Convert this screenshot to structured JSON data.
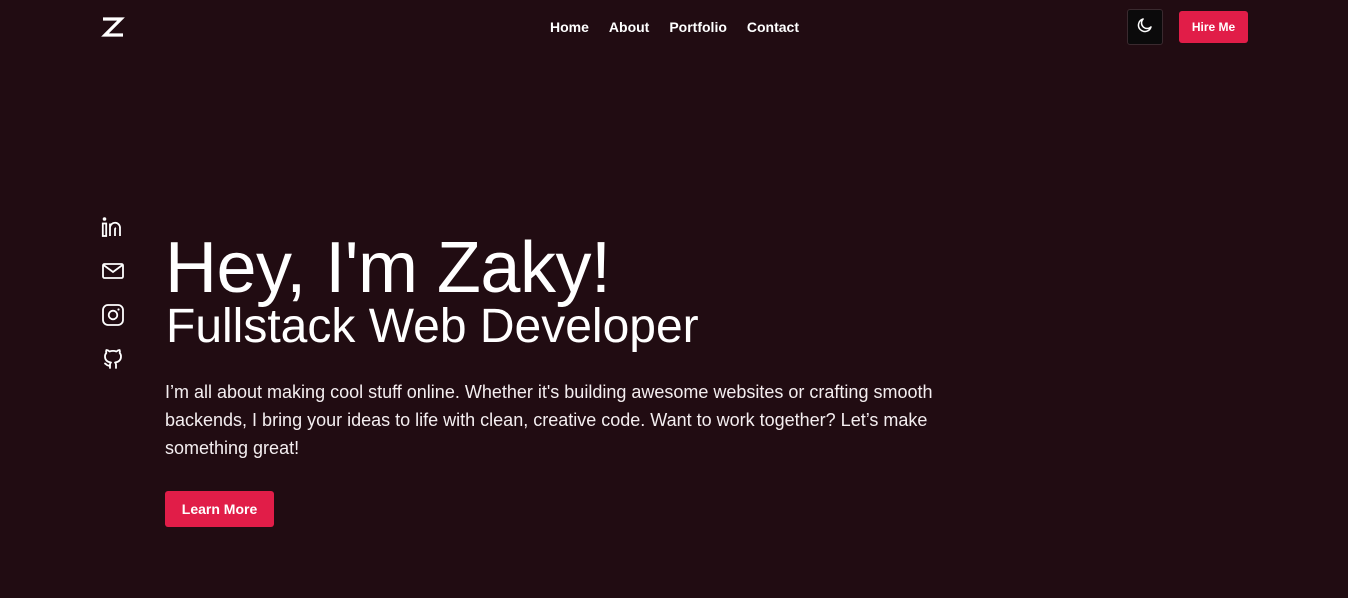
{
  "header": {
    "logo_icon": "z-logo-icon",
    "nav": [
      {
        "label": "Home"
      },
      {
        "label": "About"
      },
      {
        "label": "Portfolio"
      },
      {
        "label": "Contact"
      }
    ],
    "theme_toggle_icon": "moon-icon",
    "hire_label": "Hire Me"
  },
  "social": [
    {
      "icon": "linkedin-icon"
    },
    {
      "icon": "mail-icon"
    },
    {
      "icon": "instagram-icon"
    },
    {
      "icon": "github-icon"
    }
  ],
  "hero": {
    "title": "Hey, I'm Zaky!",
    "subtitle": "Fullstack Web Developer",
    "description": "I’m all about making cool stuff online. Whether it's building awesome websites or crafting smooth backends, I bring your ideas to life with clean, creative code. Want to work together? Let’s make something great!",
    "cta_label": "Learn More"
  },
  "colors": {
    "background": "#210c12",
    "accent": "#e11d48",
    "text": "#ffffff"
  }
}
